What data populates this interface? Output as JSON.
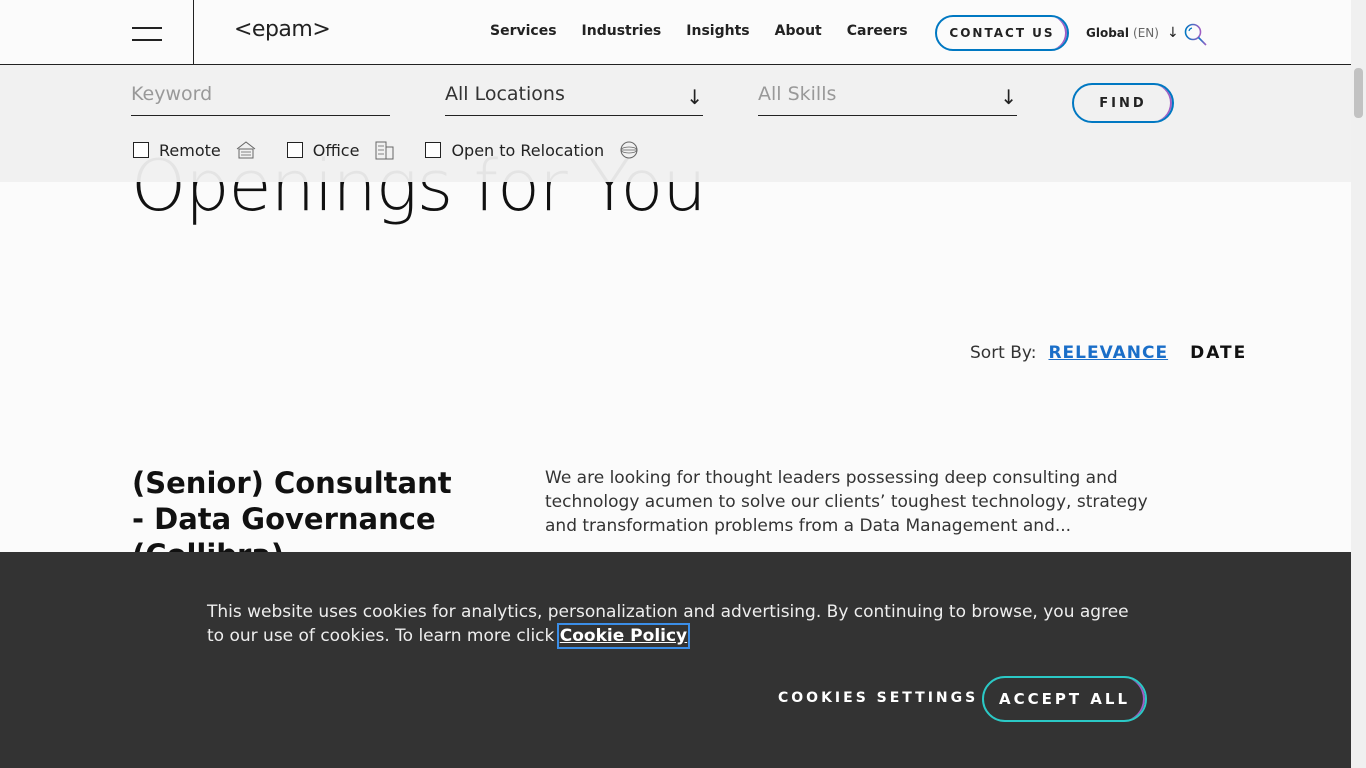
{
  "header": {
    "logo": "<epam>",
    "nav": [
      "Services",
      "Industries",
      "Insights",
      "About",
      "Careers"
    ],
    "contact": "CONTACT US",
    "lang_region": "Global",
    "lang_code": "(EN)"
  },
  "filters": {
    "keyword_placeholder": "Keyword",
    "location_value": "All Locations",
    "skills_placeholder": "All Skills",
    "find": "FIND",
    "checkboxes": [
      {
        "label": "Remote",
        "icon": "house-icon"
      },
      {
        "label": "Office",
        "icon": "building-icon"
      },
      {
        "label": "Open to Relocation",
        "icon": "globe-icon"
      }
    ]
  },
  "main": {
    "title": "Openings for You",
    "sort_label": "Sort By:",
    "sort_relevance": "RELEVANCE",
    "sort_date": "DATE",
    "job": {
      "title": "(Senior) Consultant - Data Governance (Collibra)",
      "description": "We are looking for thought leaders possessing deep consulting and technology acumen to solve our clients’ toughest technology, strategy and transformation problems from a Data Management and..."
    }
  },
  "cookie": {
    "text": "This website uses cookies for analytics, personalization and advertising. By continuing to browse, you agree to our use of cookies. To learn more click ",
    "link": "Cookie Policy",
    "settings": "COOKIES SETTINGS",
    "accept": "ACCEPT ALL"
  },
  "colors": {
    "accent_blue": "#0078c2",
    "accent_purple": "#a05ec4",
    "accent_teal": "#2bc9c6",
    "link_blue": "#1a6ec8"
  }
}
